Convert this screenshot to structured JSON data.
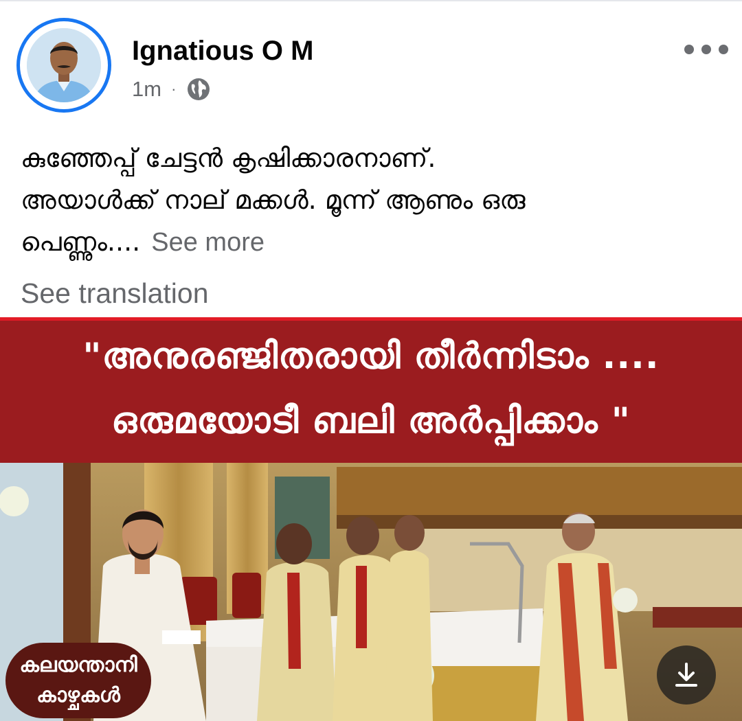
{
  "post": {
    "author": "Ignatious O M",
    "time": "1m",
    "separator": "·",
    "privacy_icon": "globe-icon",
    "more_icon": "more-dots-icon",
    "text_lines": [
      "കുഞ്ഞേപ്പ് ചേട്ടൻ കൃഷിക്കാരനാണ്.",
      "അയാൾക്ക് നാല് മക്കൾ. മൂന്ന് ആണും ഒരു",
      "പെണ്ണും...."
    ],
    "see_more": "See more",
    "see_translation": "See translation"
  },
  "image": {
    "banner_line_1": "\"അനുരഞ്ജിതരായി തീർന്നിടാം ....",
    "banner_line_2": "ഒരുമയോടീ  ബലി  അർപ്പിക്കാം \"",
    "caption_line_1": "കലയന്താനി",
    "caption_line_2": "കാഴ്ചകൾ",
    "download_icon": "download-icon",
    "colors": {
      "banner": "#9b1c1f",
      "banner_border": "#e21b26",
      "caption_bg": "#5a1712"
    }
  },
  "colors": {
    "accent": "#1877f2",
    "secondary_text": "#65676b",
    "primary_text": "#050505"
  }
}
